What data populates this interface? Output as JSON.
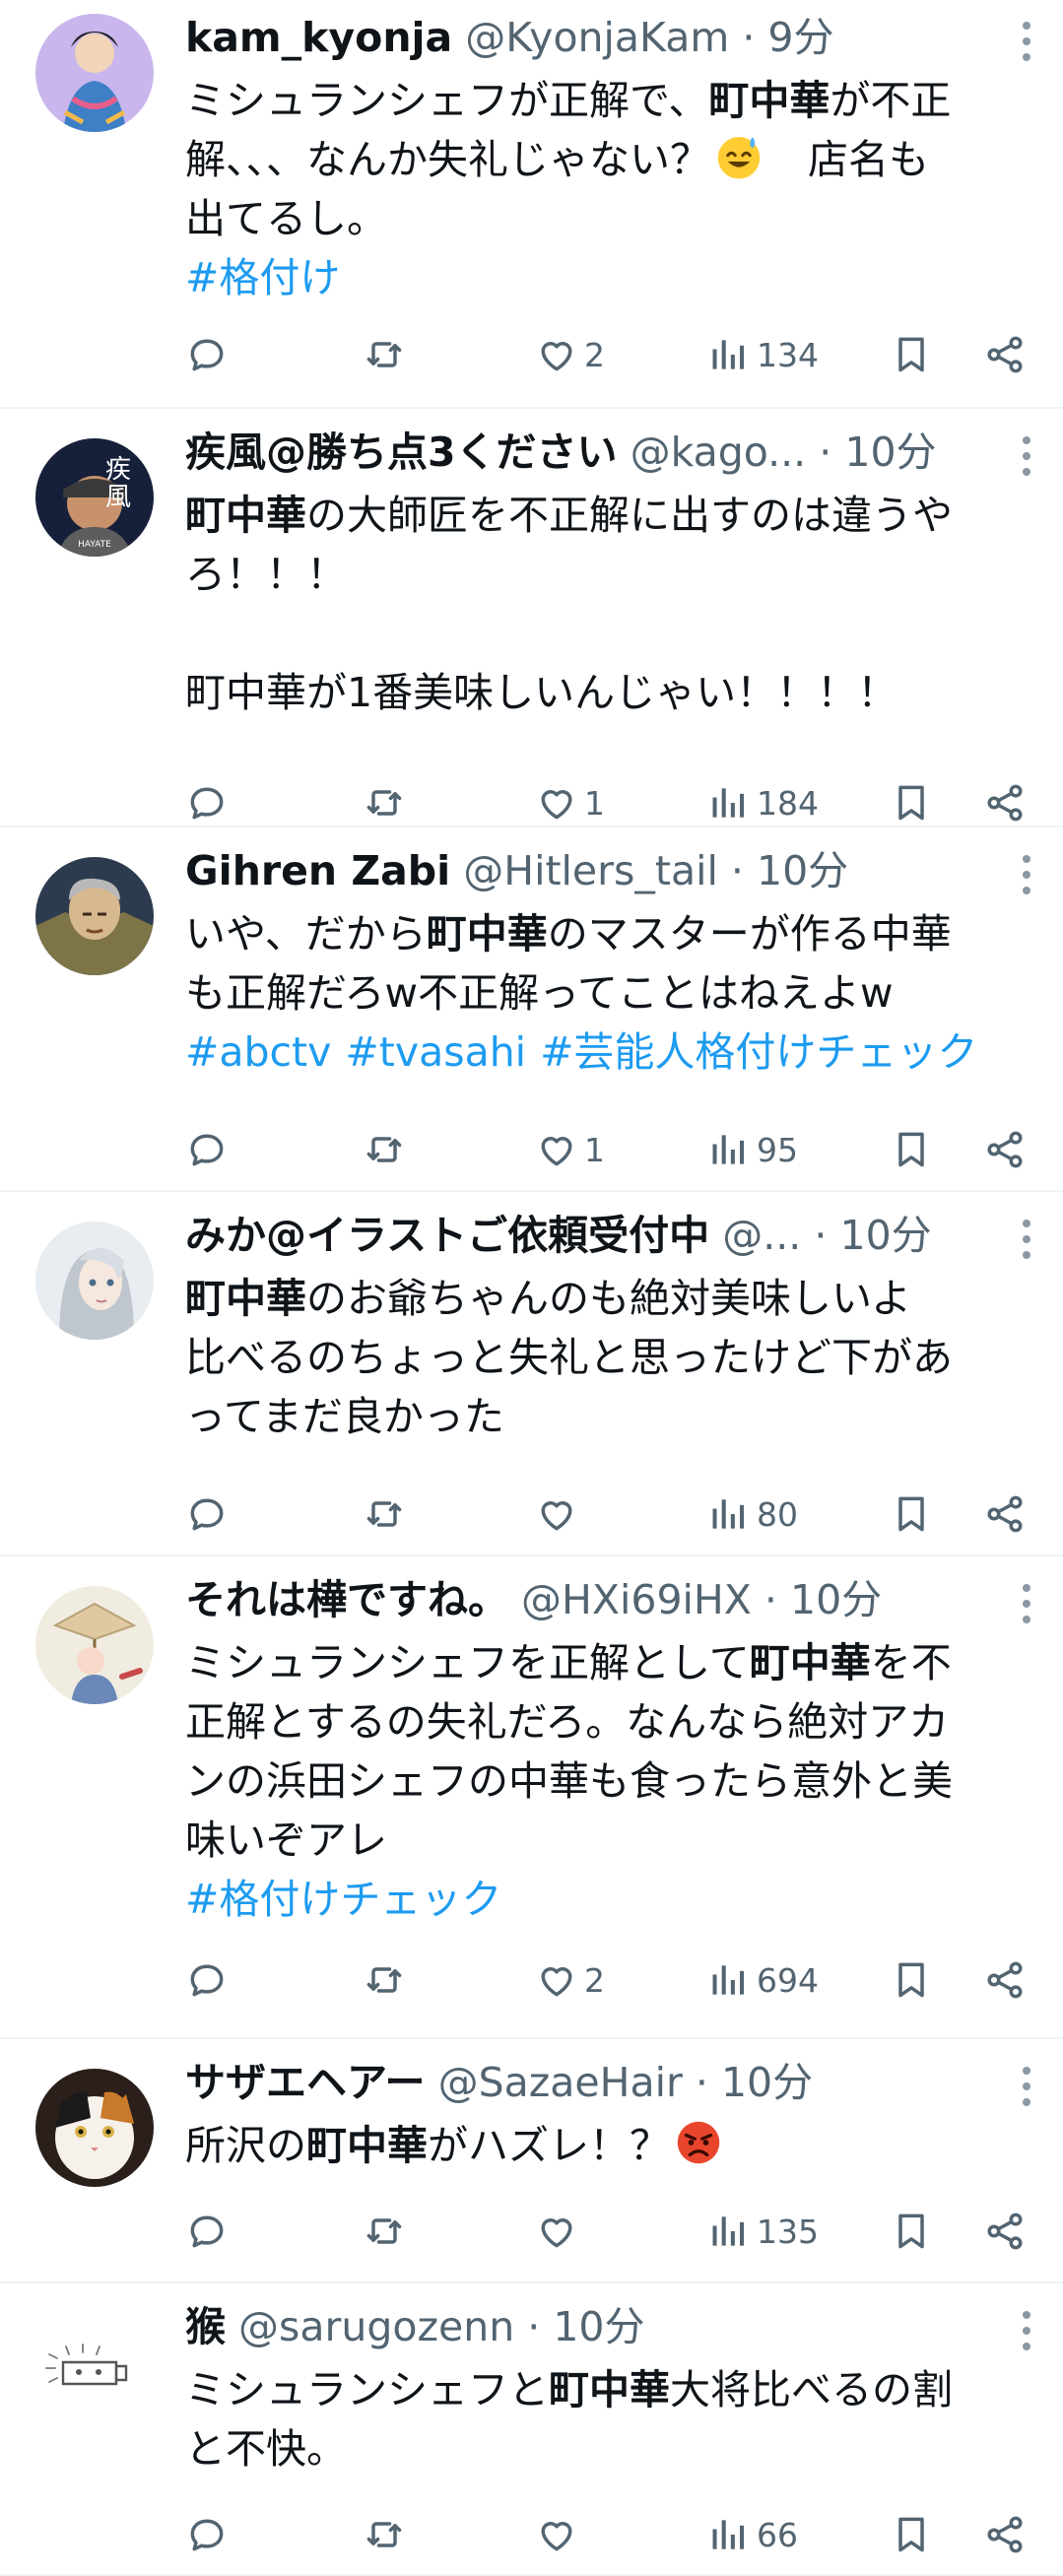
{
  "tweets": [
    {
      "name": "kam_kyonja",
      "handle": "@KyonjaKam",
      "time": "9分",
      "lines": [
        [
          {
            "t": "ミシュランシェフが正解で、"
          },
          {
            "t": "町中華",
            "b": true
          },
          {
            "t": "が不正"
          }
        ],
        [
          {
            "t": "解、、、なんか失礼じゃない？"
          },
          {
            "emoji": "sweat-smile-emoji"
          },
          {
            "t": "　店名も"
          }
        ],
        [
          {
            "t": "出てるし。"
          }
        ]
      ],
      "hashtags": [
        "#格付け"
      ],
      "likes": "2",
      "views": "134"
    },
    {
      "name": "疾風@勝ち点3ください",
      "handle": "@kago...",
      "time": "10分",
      "lines": [
        [
          {
            "t": "町中華",
            "b": true
          },
          {
            "t": "の大師匠を不正解に出すのは違うや"
          }
        ],
        [
          {
            "t": "ろ！！！"
          }
        ],
        [],
        [
          {
            "t": "町中華が1番美味しいんじゃい！！！！"
          }
        ]
      ],
      "hashtags": [],
      "likes": "1",
      "views": "184"
    },
    {
      "name": "Gihren Zabi",
      "handle": "@Hitlers_tail",
      "time": "10分",
      "lines": [
        [
          {
            "t": "いや、だから"
          },
          {
            "t": "町中華",
            "b": true
          },
          {
            "t": "のマスターが作る中華"
          }
        ],
        [
          {
            "t": "も正解だろw不正解ってことはねえよw"
          }
        ]
      ],
      "hashtags": [
        "#abctv",
        "#tvasahi",
        "#芸能人格付けチェック"
      ],
      "likes": "1",
      "views": "95"
    },
    {
      "name": "みか@イラストご依頼受付中",
      "handle": "@...",
      "time": "10分",
      "lines": [
        [
          {
            "t": "町中華",
            "b": true
          },
          {
            "t": "のお爺ちゃんのも絶対美味しいよ"
          }
        ],
        [
          {
            "t": "比べるのちょっと失礼と思ったけど下があ"
          }
        ],
        [
          {
            "t": "ってまだ良かった"
          }
        ]
      ],
      "hashtags": [],
      "likes": "",
      "views": "80"
    },
    {
      "name": "それは樺ですね。",
      "handle": "@HXi69iHX",
      "time": "10分",
      "lines": [
        [
          {
            "t": "ミシュランシェフを正解として"
          },
          {
            "t": "町中華",
            "b": true
          },
          {
            "t": "を不"
          }
        ],
        [
          {
            "t": "正解とするの失礼だろ。なんなら絶対アカ"
          }
        ],
        [
          {
            "t": "ンの浜田シェフの中華も食ったら意外と美"
          }
        ],
        [
          {
            "t": "味いぞアレ"
          }
        ]
      ],
      "hashtags": [
        "#格付けチェック"
      ],
      "likes": "2",
      "views": "694"
    },
    {
      "name": "サザエヘアー",
      "handle": "@SazaeHair",
      "time": "10分",
      "lines": [
        [
          {
            "t": "所沢の"
          },
          {
            "t": "町中華",
            "b": true
          },
          {
            "t": "がハズレ！？"
          },
          {
            "emoji": "angry-face-emoji"
          }
        ]
      ],
      "hashtags": [],
      "likes": "",
      "views": "135"
    },
    {
      "name": "猴",
      "handle": "@sarugozenn",
      "time": "10分",
      "lines": [
        [
          {
            "t": "ミシュランシェフと"
          },
          {
            "t": "町中華",
            "b": true
          },
          {
            "t": "大将比べるの割"
          }
        ],
        [
          {
            "t": "と不快。"
          }
        ]
      ],
      "hashtags": [],
      "likes": "",
      "views": "66"
    }
  ],
  "separator_dot": "·",
  "colors": {
    "text": "#0f1419",
    "muted": "#536471",
    "link": "#1d9bf0",
    "divider": "#eff3f4"
  }
}
